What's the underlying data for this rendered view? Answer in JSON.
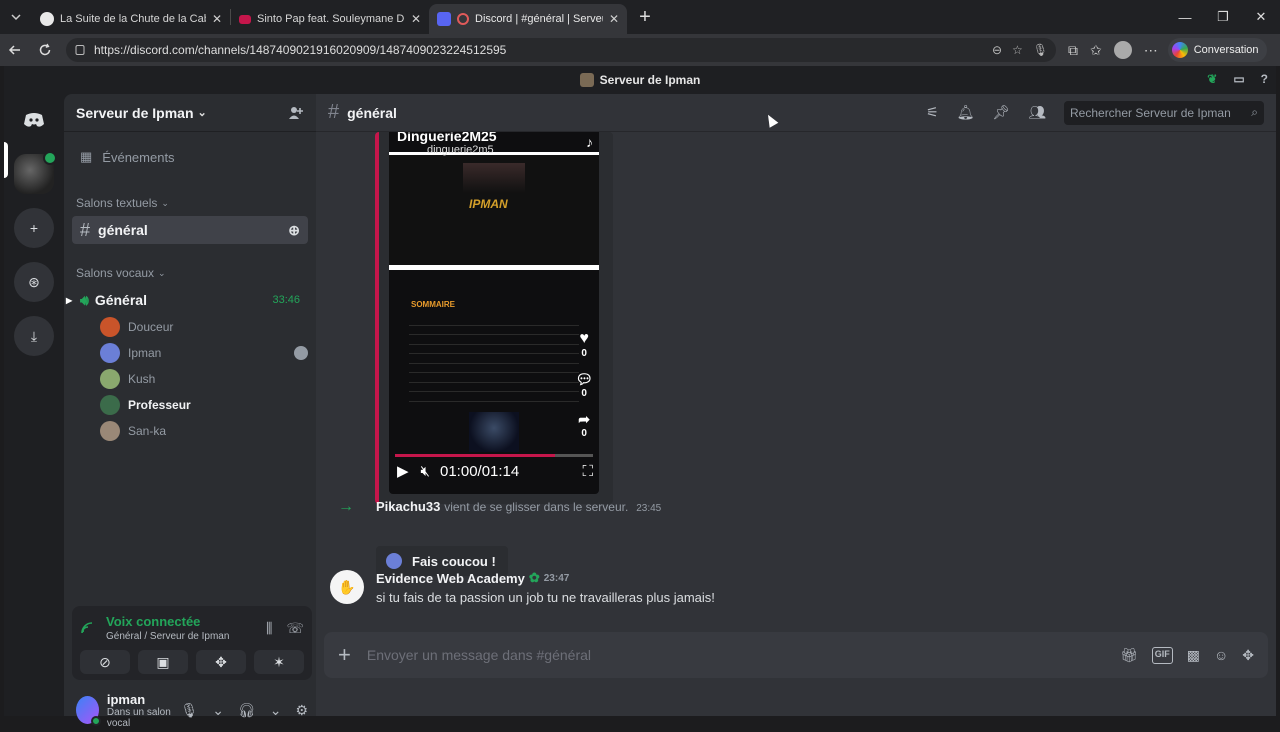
{
  "browser": {
    "tabs": [
      {
        "title": "La Suite de la Chute de la Cabale",
        "active": false,
        "favicon_color": "#e8e8e8"
      },
      {
        "title": "Sinto Pap feat. Souleymane Diama",
        "active": false,
        "favicon_color": "#c5164b"
      },
      {
        "title": "Discord | #général | Serveur de",
        "active": true,
        "favicon_color": "#5865f2"
      }
    ],
    "url": "https://discord.com/channels/1487409021916020909/1487409023224512595",
    "conversation_label": "Conversation"
  },
  "app": {
    "window_title": "Serveur de Ipman"
  },
  "sidebar": {
    "server_name": "Serveur de Ipman",
    "events_label": "Événements",
    "text_category": "Salons textuels",
    "text_channels": [
      {
        "name": "général",
        "selected": true
      }
    ],
    "voice_category": "Salons vocaux",
    "voice_channel": {
      "name": "Général",
      "time": "33:46"
    },
    "voice_users": [
      {
        "name": "Douceur",
        "color": "#c9542a",
        "bold": false
      },
      {
        "name": "Ipman",
        "color": "#6b7fd7",
        "bold": false
      },
      {
        "name": "Kush",
        "color": "#8aa86e",
        "bold": false
      },
      {
        "name": "Professeur",
        "color": "#3b6b4a",
        "bold": true
      },
      {
        "name": "San-ka",
        "color": "#9a8877",
        "bold": false
      }
    ],
    "voice_panel": {
      "status": "Voix connectée",
      "location": "Général / Serveur de Ipman"
    },
    "user": {
      "name": "ipman",
      "status": "Dans un salon vocal"
    }
  },
  "channel": {
    "name": "général",
    "search_placeholder": "Rechercher Serveur de Ipman"
  },
  "video": {
    "account": "Dinguerie2M25",
    "handle": "dinguerie2m5",
    "brand": "IPMAN",
    "section": "SOMMAIRE",
    "likes": "0",
    "comments": "0",
    "shares": "0",
    "time": "01:00/01:14",
    "progress": 0.81
  },
  "messages": [
    {
      "type": "join",
      "author": "Pikachu33",
      "text": "vient de se glisser dans le serveur.",
      "time": "23:45",
      "wave_label": "Fais coucou !"
    },
    {
      "type": "message",
      "author": "Evidence Web Academy",
      "time": "23:47",
      "text": "si tu fais de ta passion un job tu ne travailleras plus jamais!"
    }
  ],
  "composer": {
    "placeholder": "Envoyer un message dans #général"
  }
}
